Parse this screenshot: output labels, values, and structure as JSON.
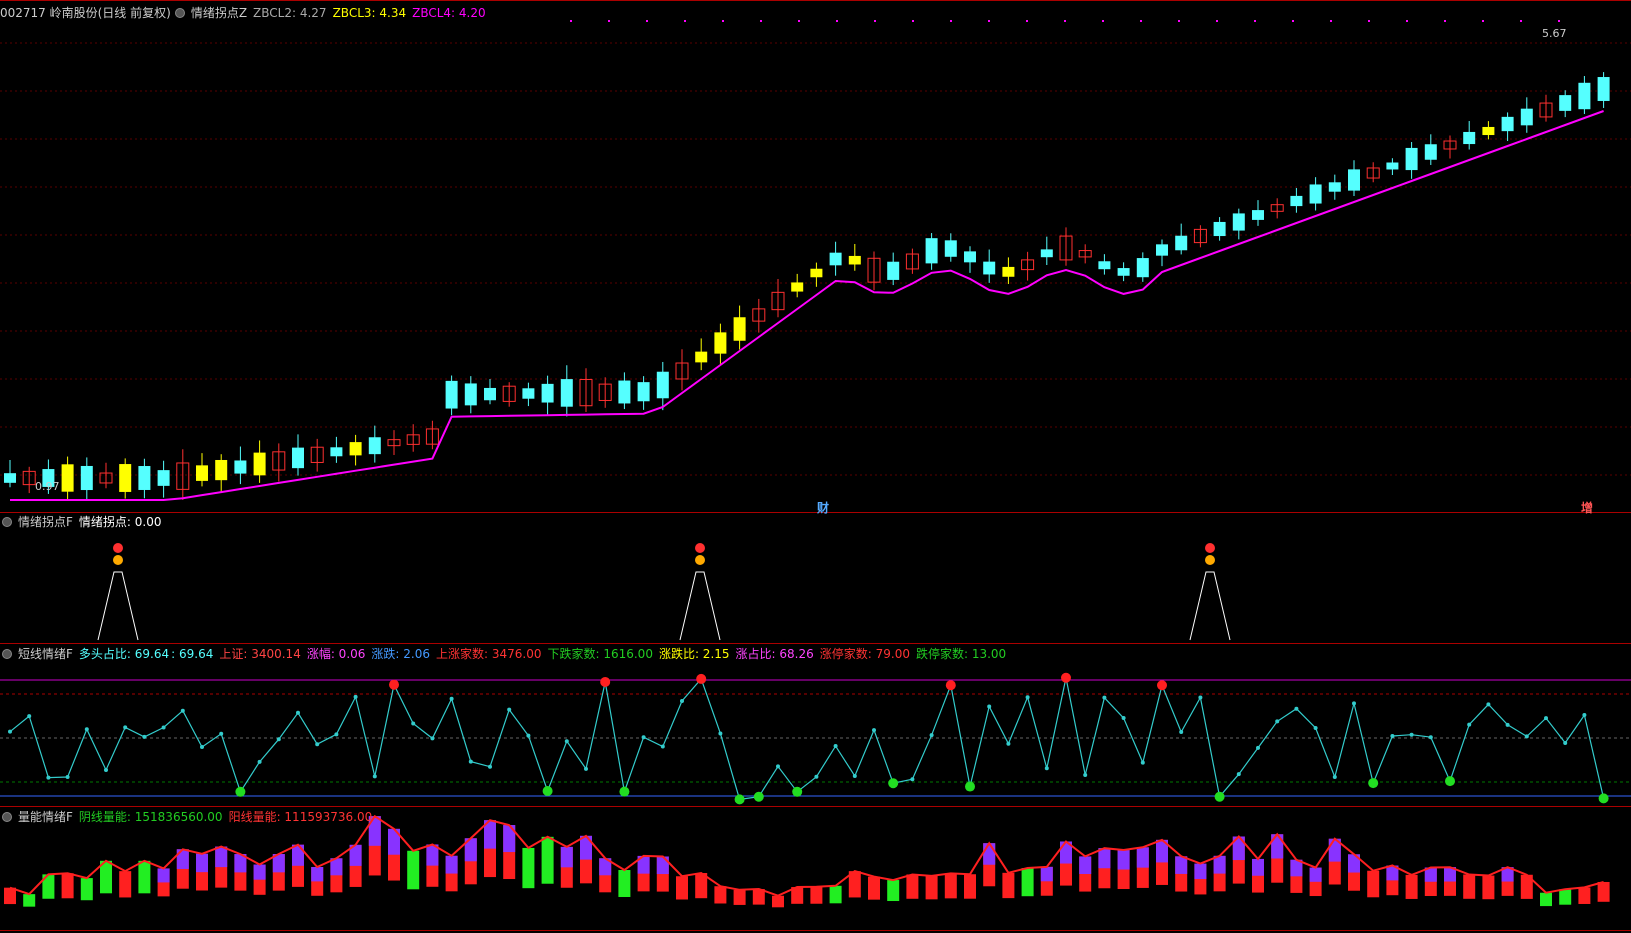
{
  "main_panel": {
    "stock": "002717 岭南股份(日线 前复权)",
    "indicator": "情绪拐点Z",
    "zbcl2_label": "ZBCL2: 4.27",
    "zbcl3_label": "ZBCL3: 4.34",
    "zbcl4_label": "ZBCL4: 4.20",
    "high_label": "5.67",
    "low_label": "0.97",
    "marker_cai": "财",
    "marker_zeng": "增",
    "colors": {
      "up": "#ff3030",
      "down": "#55ffff",
      "yang": "#ffff00",
      "ma": "#ff00ff"
    }
  },
  "panel2": {
    "name": "情绪拐点F",
    "value_label": "情绪拐点: 0.00"
  },
  "panel3": {
    "name": "短线情绪F",
    "duotou": "多头占比: 69.64",
    "duotou2": ": 69.64",
    "shangzheng": "上证: 3400.14",
    "zhangfu": "涨幅: 0.06",
    "zhangdie": "涨跌: 2.06",
    "up_count": "上涨家数: 3476.00",
    "down_count": "下跌家数: 1616.00",
    "ratio": "涨跌比: 2.15",
    "up_pct": "涨占比: 68.26",
    "limit_up": "涨停家数: 79.00",
    "limit_down": "跌停家数: 13.00"
  },
  "panel4": {
    "name": "量能情绪F",
    "yin": "阴线量能: 151836560.00",
    "yang": "阳线量能: 111593736.00"
  },
  "icons": [
    "settings-dot-icon",
    "sell-signal-icon",
    "buy-signal-icon",
    "money-bag-icon"
  ]
}
